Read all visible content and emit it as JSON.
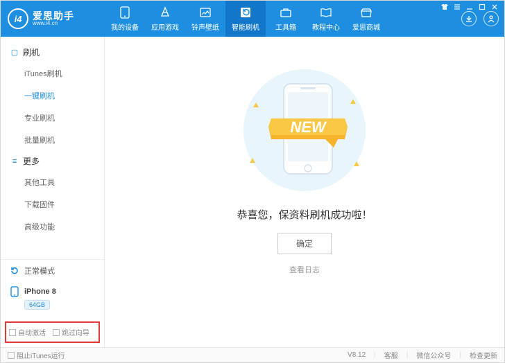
{
  "brand": {
    "logo_text": "i4",
    "title": "爱思助手",
    "subtitle": "www.i4.cn"
  },
  "nav": [
    {
      "label": "我的设备"
    },
    {
      "label": "应用游戏"
    },
    {
      "label": "铃声壁纸"
    },
    {
      "label": "智能刷机"
    },
    {
      "label": "工具箱"
    },
    {
      "label": "教程中心"
    },
    {
      "label": "爱思商城"
    }
  ],
  "sidebar": {
    "group1": "刷机",
    "items1": [
      "iTunes刷机",
      "一键刷机",
      "专业刷机",
      "批量刷机"
    ],
    "group2": "更多",
    "items2": [
      "其他工具",
      "下载固件",
      "高级功能"
    ]
  },
  "mode": {
    "label": "正常模式"
  },
  "device": {
    "name": "iPhone 8",
    "storage": "64GB"
  },
  "checks": {
    "auto_activate": "自动激活",
    "skip_guide": "跳过向导"
  },
  "main": {
    "ribbon_text": "NEW",
    "success": "恭喜您，保资料刷机成功啦！",
    "ok": "确定",
    "view_log": "查看日志"
  },
  "footer": {
    "block_itunes": "阻止iTunes运行",
    "version": "V8.12",
    "support": "客服",
    "wechat": "微信公众号",
    "update": "检查更新"
  }
}
